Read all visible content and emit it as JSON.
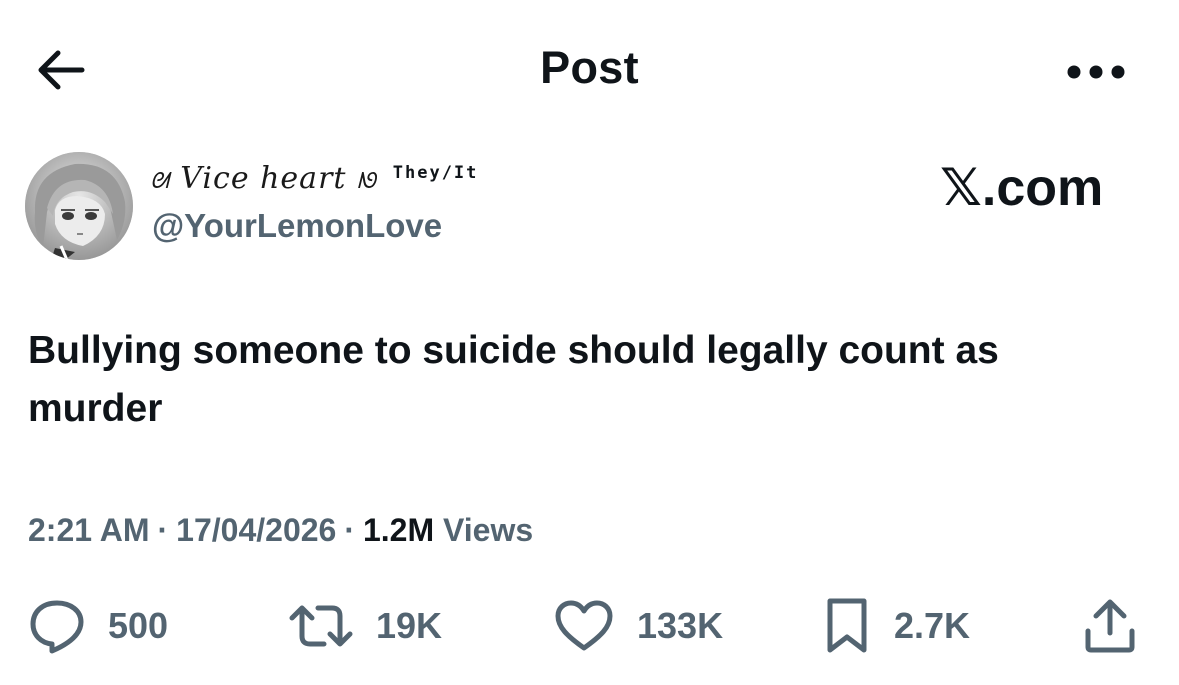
{
  "header": {
    "title": "Post",
    "back_icon": "arrow-left-icon",
    "more_icon": "ellipsis-icon"
  },
  "author": {
    "display_name": "Vice heart",
    "pronouns": "They/It",
    "handle": "@YourLemonLove",
    "avatar": "anime-avatar"
  },
  "source": {
    "label": "𝕏.com"
  },
  "post": {
    "text": "Bullying someone to suicide should legally count as murder"
  },
  "meta": {
    "time": "2:21 AM",
    "date": "17/04/2026",
    "views_count": "1.2M",
    "views_label": "Views",
    "separator": "·"
  },
  "actions": {
    "replies": "500",
    "reposts": "19K",
    "likes": "133K",
    "bookmarks": "2.7K",
    "share_icon": "share-icon"
  },
  "colors": {
    "text_primary": "#0f1419",
    "text_secondary": "#536471",
    "background": "#ffffff"
  }
}
